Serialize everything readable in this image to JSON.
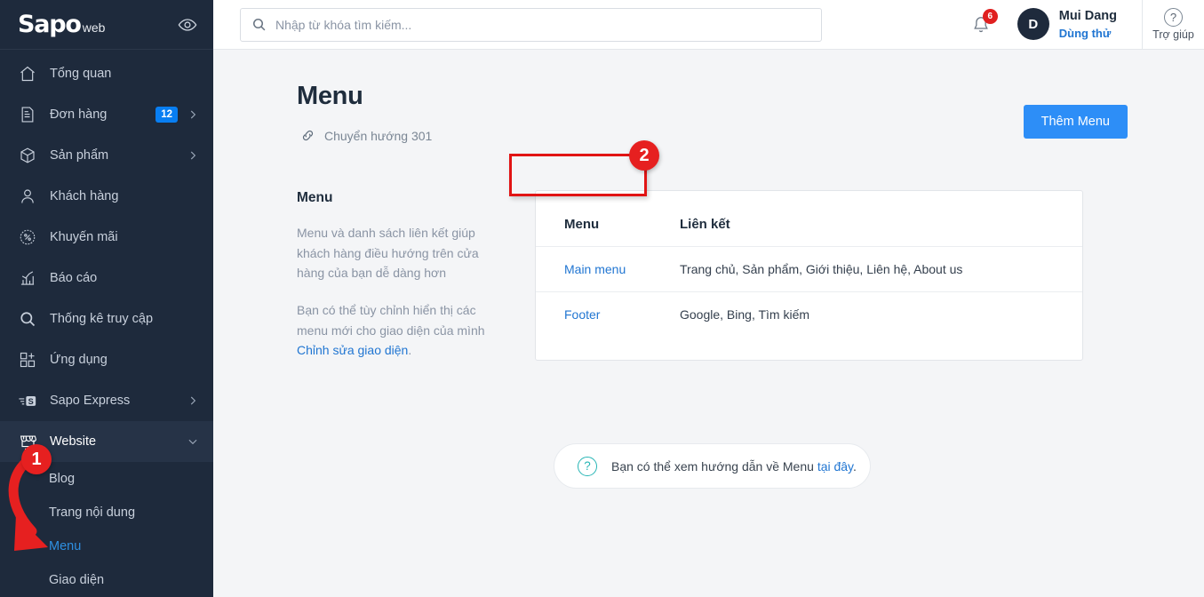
{
  "brand": {
    "logo_main": "Sapo",
    "logo_sub": "web",
    "eye_icon": "eye-icon",
    "accent_blue": "#2d8ef7",
    "sidebar_bg": "#1e2a3c",
    "annotation_red": "#e11414",
    "teal": "#27b5b5"
  },
  "sidebar": {
    "items": [
      {
        "label": "Tổng quan",
        "icon": "home-icon",
        "badge": null,
        "chevron": null,
        "active": false
      },
      {
        "label": "Đơn hàng",
        "icon": "invoice-icon",
        "badge": "12",
        "chevron": "right",
        "active": false
      },
      {
        "label": "Sản phẩm",
        "icon": "box-icon",
        "badge": null,
        "chevron": "right",
        "active": false
      },
      {
        "label": "Khách hàng",
        "icon": "user-icon",
        "badge": null,
        "chevron": null,
        "active": false
      },
      {
        "label": "Khuyến mãi",
        "icon": "discount-icon",
        "badge": null,
        "chevron": null,
        "active": false
      },
      {
        "label": "Báo cáo",
        "icon": "bar-chart-icon",
        "badge": null,
        "chevron": null,
        "active": false
      },
      {
        "label": "Thống kê truy cập",
        "icon": "search-icon",
        "badge": null,
        "chevron": null,
        "active": false
      },
      {
        "label": "Ứng dụng",
        "icon": "apps-plus-icon",
        "badge": null,
        "chevron": null,
        "active": false
      },
      {
        "label": "Sapo Express",
        "icon": "express-icon",
        "badge": null,
        "chevron": "right",
        "active": false
      },
      {
        "label": "Website",
        "icon": "storefront-icon",
        "badge": null,
        "chevron": "down",
        "active": true
      }
    ],
    "subitems": [
      {
        "label": "Blog",
        "selected": false
      },
      {
        "label": "Trang nội dung",
        "selected": false
      },
      {
        "label": "Menu",
        "selected": true
      },
      {
        "label": "Giao diện",
        "selected": false
      }
    ]
  },
  "topbar": {
    "search": {
      "placeholder": "Nhập từ khóa tìm kiếm...",
      "value": "",
      "icon": "search-icon"
    },
    "notifications": {
      "icon": "bell-icon",
      "count": "6"
    },
    "user": {
      "initial": "D",
      "name": "Mui Dang",
      "plan": "Dùng thử"
    },
    "help": {
      "icon": "question-circle-icon",
      "label": "Trợ giúp",
      "glyph": "?"
    }
  },
  "page": {
    "title": "Menu",
    "redirect_link": {
      "label": "Chuyển hướng 301",
      "icon": "link-icon"
    },
    "add_button": "Thêm Menu"
  },
  "panel_left": {
    "heading": "Menu",
    "paragraph1": "Menu và danh sách liên kết giúp khách hàng điều hướng trên cửa hàng của bạn dễ dàng hơn",
    "paragraph2_pre": "Bạn có thể tùy chỉnh hiển thị các menu mới cho giao diện của mình ",
    "paragraph2_link": "Chỉnh sửa giao diện",
    "paragraph2_post": "."
  },
  "table": {
    "headers": [
      "Menu",
      "Liên kết"
    ],
    "rows": [
      {
        "menu": "Main menu",
        "links": "Trang chủ, Sản phẩm, Giới thiệu, Liên hệ, About us"
      },
      {
        "menu": "Footer",
        "links": "Google, Bing, Tìm kiếm"
      }
    ]
  },
  "hint": {
    "icon": "question-circle-icon",
    "glyph": "?",
    "text_pre": "Bạn có thể xem hướng dẫn về Menu ",
    "link": "tại đây",
    "text_post": "."
  },
  "annotations": {
    "step1": "1",
    "step2": "2"
  }
}
